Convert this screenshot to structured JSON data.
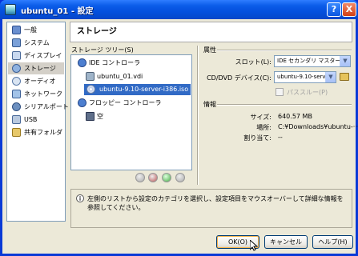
{
  "window": {
    "title": "ubuntu_01 - 設定",
    "help_button": "?",
    "close_button": "X"
  },
  "sidebar": {
    "items": [
      {
        "label": "一般",
        "icon": "general-icon"
      },
      {
        "label": "システム",
        "icon": "system-icon"
      },
      {
        "label": "ディスプレイ",
        "icon": "display-icon"
      },
      {
        "label": "ストレージ",
        "icon": "storage-icon",
        "selected": true
      },
      {
        "label": "オーディオ",
        "icon": "audio-icon"
      },
      {
        "label": "ネットワーク",
        "icon": "network-icon"
      },
      {
        "label": "シリアルポート",
        "icon": "serial-port-icon"
      },
      {
        "label": "USB",
        "icon": "usb-icon"
      },
      {
        "label": "共有フォルダ",
        "icon": "shared-folder-icon"
      }
    ]
  },
  "header": {
    "title": "ストレージ"
  },
  "storage_tree": {
    "label": "ストレージ ツリー(S)",
    "nodes": [
      {
        "label": "IDE コントローラ"
      },
      {
        "label": "ubuntu_01.vdi"
      },
      {
        "label": "ubuntu-9.10-server-i386.iso",
        "selected": true
      },
      {
        "label": "フロッピー コントローラ"
      },
      {
        "label": "空"
      }
    ]
  },
  "attributes": {
    "section_label": "属性",
    "slot_label": "スロット(L):",
    "slot_value": "IDE セカンダリ マスター",
    "cd_label": "CD/DVD デバイス(C):",
    "cd_value": "ubuntu-9.10-serv",
    "passthrough_label": "パススルー(P)"
  },
  "info": {
    "section_label": "情報",
    "size_label": "サイズ:",
    "size_value": "640.57 MB",
    "location_label": "場所:",
    "location_value": "C:¥Downloads¥ubuntu-···",
    "attached_label": "割り当て:",
    "attached_value": "--"
  },
  "description": "左側のリストから設定のカテゴリを選択し、設定項目をマウスオーバーして詳細な情報を参照してください。",
  "buttons": {
    "ok": "OK(O)",
    "cancel": "キャンセル",
    "help": "ヘルプ(H)"
  }
}
